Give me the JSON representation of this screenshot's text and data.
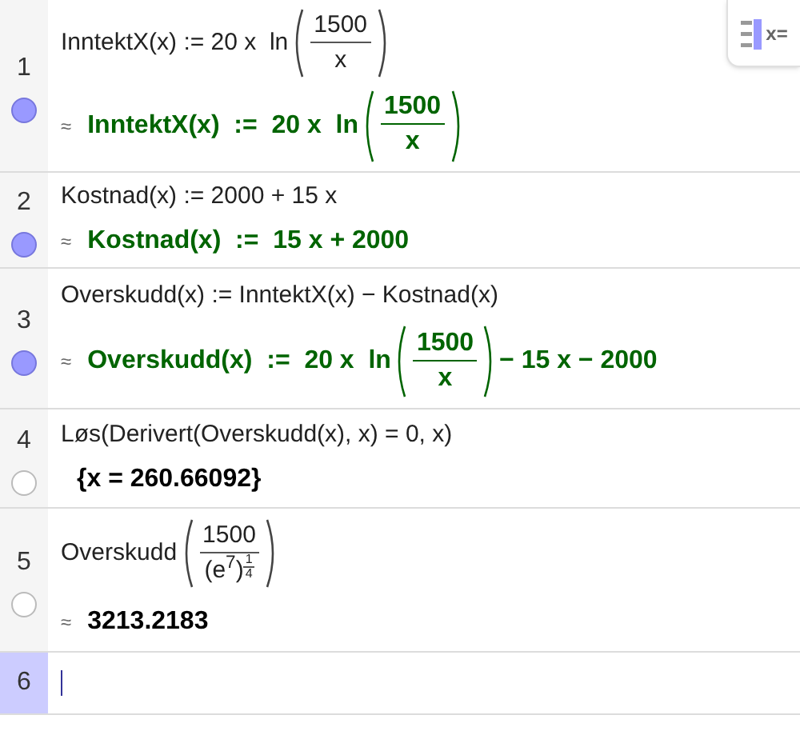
{
  "toolbar_button": {
    "label": "x="
  },
  "rows": [
    {
      "number": "1",
      "visible": true,
      "selected": false,
      "kind": "definition",
      "approx": "≈",
      "input": [
        {
          "kind": "text",
          "text": "InntektX(x) := 20 x  ln"
        },
        {
          "kind": "pfrac",
          "num": "1500",
          "den": "x"
        }
      ],
      "output": [
        {
          "kind": "text",
          "text": "InntektX(x)  :=  20 x  ln"
        },
        {
          "kind": "pfrac",
          "num": "1500",
          "den": "x"
        }
      ]
    },
    {
      "number": "2",
      "visible": true,
      "selected": false,
      "kind": "definition",
      "approx": "≈",
      "input": [
        {
          "kind": "text",
          "text": "Kostnad(x) := 2000 + 15 x"
        }
      ],
      "output": [
        {
          "kind": "text",
          "text": "Kostnad(x)  :=  15 x + 2000"
        }
      ]
    },
    {
      "number": "3",
      "visible": true,
      "selected": false,
      "kind": "definition",
      "approx": "≈",
      "input": [
        {
          "kind": "text",
          "text": "Overskudd(x) := InntektX(x) − Kostnad(x)"
        }
      ],
      "output": [
        {
          "kind": "text",
          "text": "Overskudd(x)  :=  20 x  ln"
        },
        {
          "kind": "pfrac",
          "num": "1500",
          "den": "x"
        },
        {
          "kind": "text",
          "text": "− 15 x − 2000"
        }
      ]
    },
    {
      "number": "4",
      "visible": false,
      "selected": false,
      "kind": "value",
      "approx": "",
      "input": [
        {
          "kind": "text",
          "text": "Løs(Derivert(Overskudd(x), x) = 0, x)"
        }
      ],
      "output": [
        {
          "kind": "text",
          "text": "{x = 260.66092}"
        }
      ]
    },
    {
      "number": "5",
      "visible": false,
      "selected": false,
      "kind": "value",
      "approx": "≈",
      "input": [
        {
          "kind": "text",
          "text": "Overskudd"
        },
        {
          "kind": "pfrac",
          "num": "1500",
          "den": "(e$^{7}$)",
          "den_exp_num": "1",
          "den_exp_den": "4"
        }
      ],
      "output": [
        {
          "kind": "text",
          "text": "3213.2183"
        }
      ]
    },
    {
      "number": "6",
      "selected": true,
      "input": [],
      "output": []
    }
  ]
}
